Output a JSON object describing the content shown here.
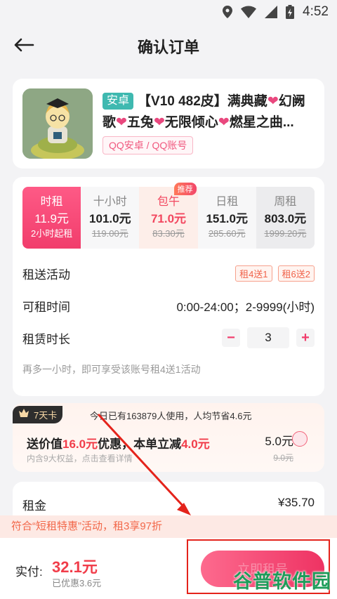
{
  "status_bar": {
    "time": "4:52"
  },
  "nav": {
    "title": "确认订单"
  },
  "product": {
    "platform_tag": "安卓",
    "title_parts": [
      "【V10 482皮】满典藏",
      "❤",
      "幻阙歌",
      "❤",
      "五兔",
      "❤",
      "无限倾心",
      "❤",
      "燃星之曲..."
    ],
    "account_tag": "QQ安卓 / QQ账号"
  },
  "plans": [
    {
      "name": "时租",
      "price": "11.9元",
      "note": "2小时起租",
      "old": ""
    },
    {
      "name": "十小时",
      "price": "101.0元",
      "note": "",
      "old": "119.00元"
    },
    {
      "name": "包午",
      "price": "71.0元",
      "note": "",
      "old": "83.30元",
      "badge": "推荐"
    },
    {
      "name": "日租",
      "price": "151.0元",
      "note": "",
      "old": "285.60元"
    },
    {
      "name": "周租",
      "price": "803.0元",
      "note": "",
      "old": "1999.20元"
    }
  ],
  "rental": {
    "activity_label": "租送活动",
    "activity_chips": [
      "租4送1",
      "租6送2"
    ],
    "time_label": "可租时间",
    "time_value": "0:00-24:00；2-9999(小时)",
    "duration_label": "租赁时长",
    "duration_value": "3",
    "minus": "−",
    "plus": "+",
    "hint": "再多一小时，即可享受该账号租4送1活动"
  },
  "week_card": {
    "badge": "7天卡",
    "usage": "今日已有163879人使用，人均节省4.6元",
    "main_prefix": "送价值",
    "main_value": "16.0元",
    "main_mid": "优惠，本单立减",
    "main_cut": "4.0元",
    "sub": "内含9大权益，点击查看详情",
    "price_now": "5.0元",
    "price_was": "9.0元"
  },
  "rent": {
    "label": "租金",
    "value": "¥35.70"
  },
  "activity_bar": "符合“短租特惠”活动，租3享97折",
  "bottom": {
    "pay_label": "实付:",
    "pay_amount": "32.1元",
    "discount": "已优惠3.6元",
    "submit": "立即租号"
  },
  "watermark": "谷普软件园",
  "colors": {
    "accent": "#f13d6c",
    "annotation": "#e4231b",
    "watermark": "#1e9c5a"
  }
}
